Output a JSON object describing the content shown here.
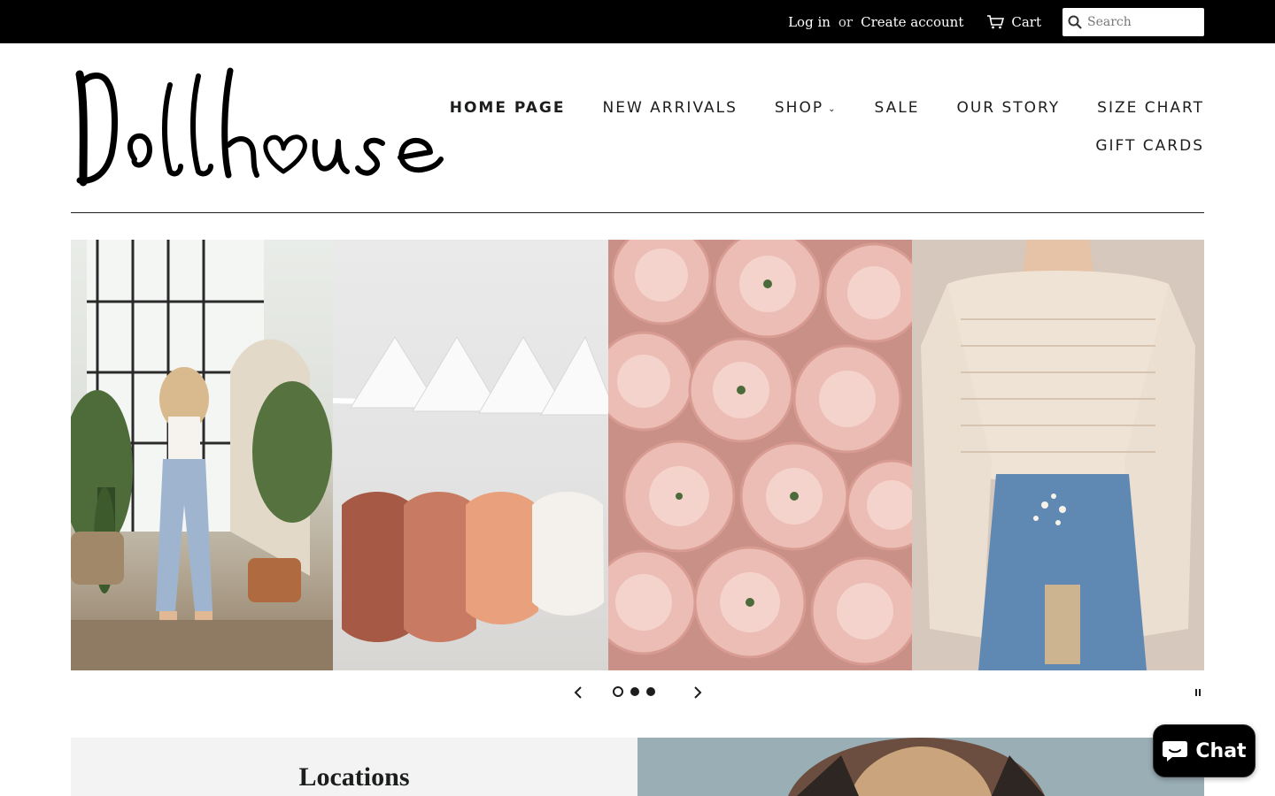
{
  "topbar": {
    "login": "Log in",
    "or": "or",
    "create_account": "Create account",
    "cart": "Cart",
    "search_placeholder": "Search"
  },
  "brand": {
    "logo_text": "Dollhouse"
  },
  "nav": {
    "items": [
      {
        "label": "HOME PAGE"
      },
      {
        "label": "NEW ARRIVALS"
      },
      {
        "label": "SHOP"
      },
      {
        "label": "SALE"
      },
      {
        "label": "OUR STORY"
      },
      {
        "label": "SIZE CHART"
      },
      {
        "label": "GIFT CARDS"
      }
    ]
  },
  "slideshow": {
    "slide_count": 3,
    "active_slide": 1
  },
  "sections": {
    "locations_title": "Locations"
  },
  "chat": {
    "label": "Chat"
  },
  "colors": {
    "topbar": "#000000",
    "text": "#1c1d1d",
    "panel": "#f3f3f3"
  }
}
